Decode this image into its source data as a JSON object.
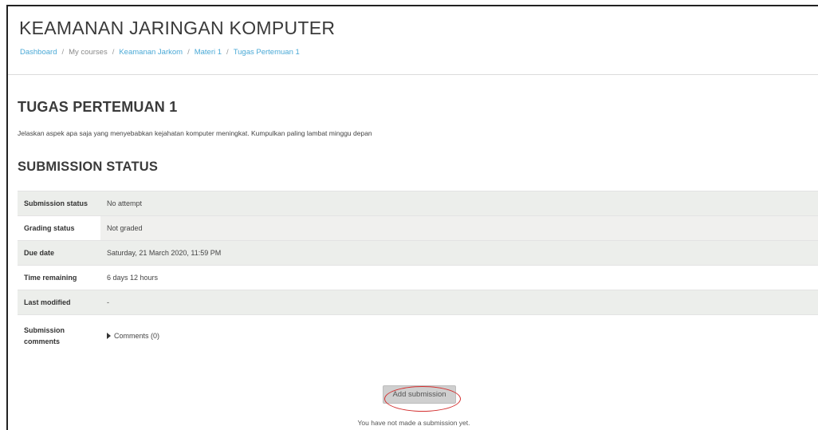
{
  "header": {
    "title": "KEAMANAN JARINGAN KOMPUTER",
    "breadcrumb": [
      "Dashboard",
      "My courses",
      "Keamanan Jarkom",
      "Materi 1",
      "Tugas Pertemuan 1"
    ],
    "separator": "/"
  },
  "activity": {
    "title": "TUGAS PERTEMUAN 1",
    "intro": "Jelaskan aspek apa saja yang menyebabkan kejahatan komputer meningkat. Kumpulkan paling lambat minggu depan"
  },
  "submission": {
    "heading": "SUBMISSION STATUS",
    "rows": [
      {
        "label": "Submission status",
        "value": "No attempt"
      },
      {
        "label": "Grading status",
        "value": "Not graded"
      },
      {
        "label": "Due date",
        "value": "Saturday, 21 March 2020, 11:59 PM"
      },
      {
        "label": "Time remaining",
        "value": "6 days 12 hours"
      },
      {
        "label": "Last modified",
        "value": "-"
      },
      {
        "label": "Submission comments",
        "value": "Comments (0)"
      }
    ],
    "add_button": "Add submission",
    "note": "You have not made a submission yet."
  },
  "colors": {
    "link": "#4aa9d6",
    "row_shade": "#eceeeb",
    "annotation": "#d32f2f"
  }
}
